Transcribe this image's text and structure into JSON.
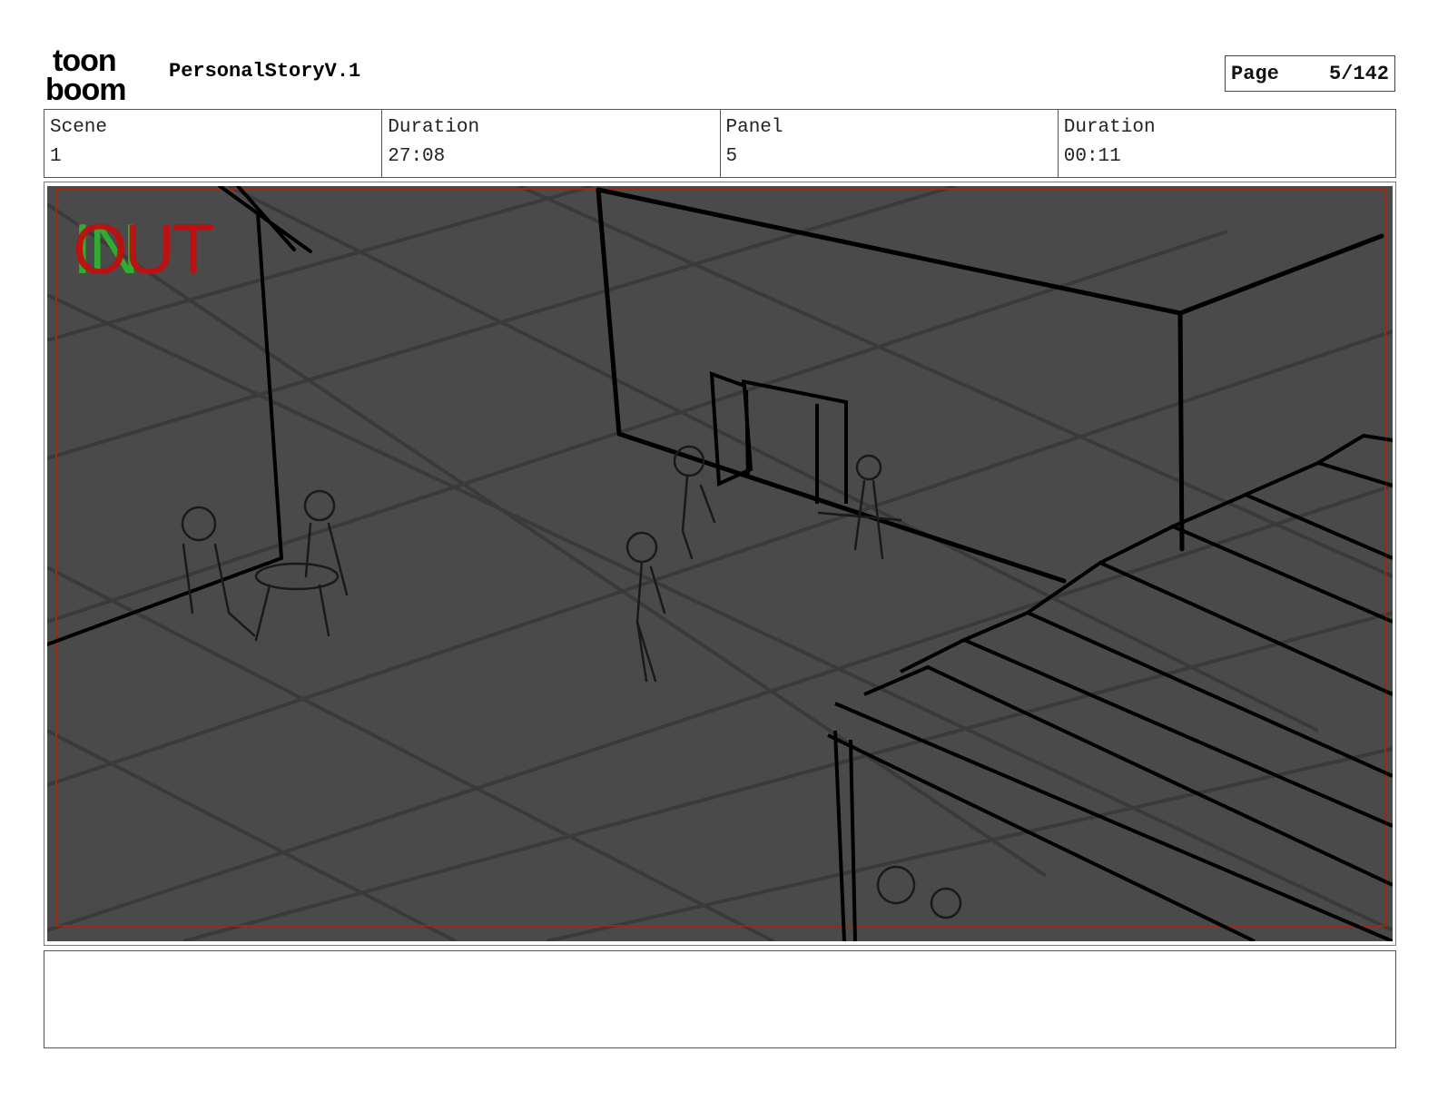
{
  "header": {
    "logo_line1": "toon",
    "logo_line2": "boom",
    "project_title": "PersonalStoryV.1",
    "page_label": "Page",
    "page_value": "5/142"
  },
  "info": [
    {
      "label": "Scene",
      "value": "1"
    },
    {
      "label": "Duration",
      "value": "27:08"
    },
    {
      "label": "Panel",
      "value": "5"
    },
    {
      "label": "Duration",
      "value": "00:11"
    }
  ],
  "panel": {
    "in_marker": "IN",
    "out_marker": "OUT",
    "in_color": "#2eb82e",
    "out_color": "#c01010",
    "background": "#4a4a4a"
  },
  "notes": {
    "text": ""
  }
}
